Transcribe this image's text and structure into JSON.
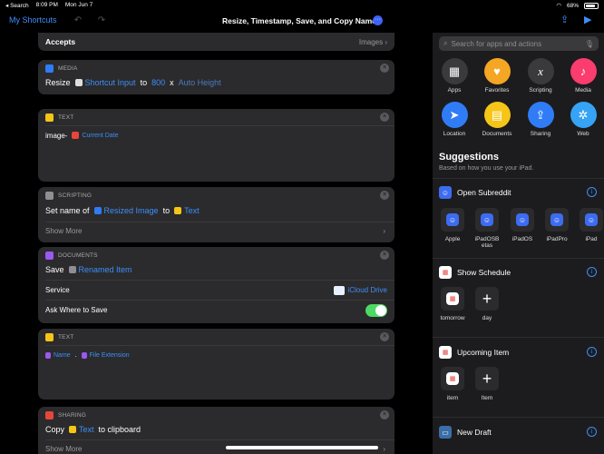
{
  "status": {
    "back": "◂ Search",
    "time": "8:09 PM",
    "date": "Mon Jun 7",
    "battery": "68%"
  },
  "nav": {
    "back": "My Shortcuts",
    "title": "Resize, Timestamp, Save, and Copy Name"
  },
  "accepts": {
    "label": "Accepts",
    "value": "Images"
  },
  "media": {
    "header": "MEDIA",
    "verb": "Resize",
    "input": "Shortcut Input",
    "to": "to",
    "width": "800",
    "x": "x",
    "height": "Auto Height"
  },
  "text1": {
    "header": "TEXT",
    "prefix": "image-",
    "var": "Current Date"
  },
  "scripting": {
    "header": "SCRIPTING",
    "verb": "Set name of",
    "var": "Resized Image",
    "to": "to",
    "target": "Text",
    "show_more": "Show More"
  },
  "documents": {
    "header": "DOCUMENTS",
    "verb": "Save",
    "var": "Renamed Item",
    "service_label": "Service",
    "service_value": "iCloud Drive",
    "ask_label": "Ask Where to Save",
    "ask_value": true
  },
  "text2": {
    "header": "TEXT",
    "var1": "Name",
    "dot": ".",
    "var2": "File Extension"
  },
  "sharing": {
    "header": "SHARING",
    "verb": "Copy",
    "var": "Text",
    "suffix": "to clipboard",
    "show_more": "Show More"
  },
  "panel": {
    "search_placeholder": "Search for apps and actions",
    "categories": [
      {
        "label": "Apps",
        "icon": "grid-icon",
        "color": "#3a3a3c"
      },
      {
        "label": "Favorites",
        "icon": "heart-icon",
        "color": "#f5a623"
      },
      {
        "label": "Scripting",
        "icon": "x-icon",
        "color": "#3a3a3c"
      },
      {
        "label": "Media",
        "icon": "music-icon",
        "color": "#fa3c6e"
      },
      {
        "label": "Location",
        "icon": "location-icon",
        "color": "#2f7cf6"
      },
      {
        "label": "Documents",
        "icon": "document-icon",
        "color": "#f5c518"
      },
      {
        "label": "Sharing",
        "icon": "share-icon",
        "color": "#2f7cf6"
      },
      {
        "label": "Web",
        "icon": "compass-icon",
        "color": "#36a3f5"
      }
    ],
    "suggestions_title": "Suggestions",
    "suggestions_sub": "Based on how you use your iPad.",
    "groups": [
      {
        "title": "Open Subreddit",
        "tiles": [
          "Apple",
          "iPadOSB etas",
          "iPadOS",
          "iPadPro",
          "iPad"
        ]
      },
      {
        "title": "Show Schedule",
        "tiles": [
          "tomorrow",
          "day"
        ]
      },
      {
        "title": "Upcoming Item",
        "tiles": [
          "item",
          "Item"
        ]
      },
      {
        "title": "New Draft",
        "tiles": []
      }
    ]
  }
}
